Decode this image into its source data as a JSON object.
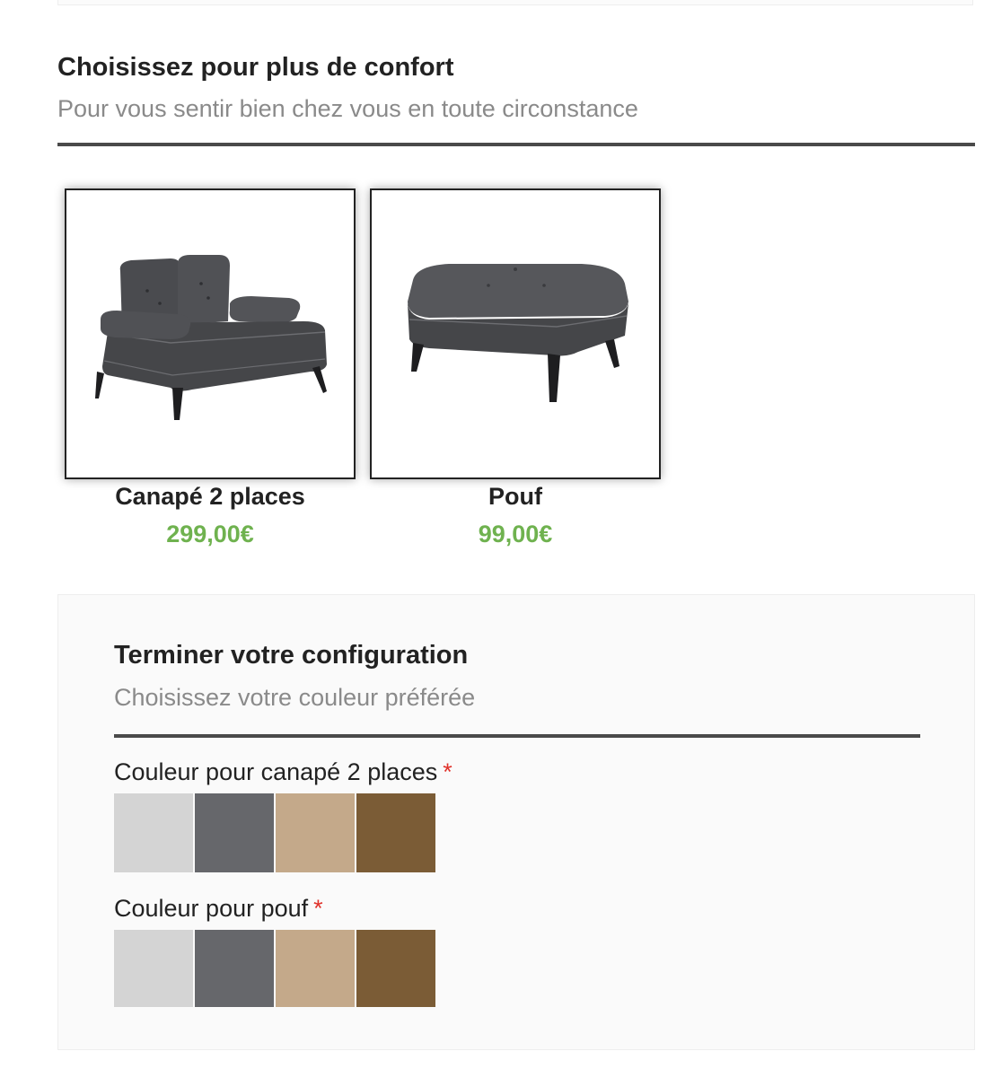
{
  "section": {
    "title": "Choisissez pour plus de confort",
    "subtitle": "Pour vous sentir bien chez vous en toute circonstance"
  },
  "products": [
    {
      "name": "Canapé 2 places",
      "price": "299,00€",
      "icon": "sofa-2-seater-image"
    },
    {
      "name": "Pouf",
      "price": "99,00€",
      "icon": "ottoman-pouf-image"
    }
  ],
  "colors": {
    "price": "#6fb24f",
    "required": "#e0322b",
    "rule": "#4a4a4a"
  },
  "configuration": {
    "title": "Terminer votre configuration",
    "subtitle": "Choisissez votre couleur préférée",
    "fields": [
      {
        "label": "Couleur pour canapé 2 places",
        "required_mark": "*",
        "swatches": [
          "#d4d4d4",
          "#66676b",
          "#c4a98a",
          "#7b5c36"
        ]
      },
      {
        "label": "Couleur pour pouf",
        "required_mark": "*",
        "swatches": [
          "#d4d4d4",
          "#66676b",
          "#c4a98a",
          "#7b5c36"
        ]
      }
    ]
  }
}
